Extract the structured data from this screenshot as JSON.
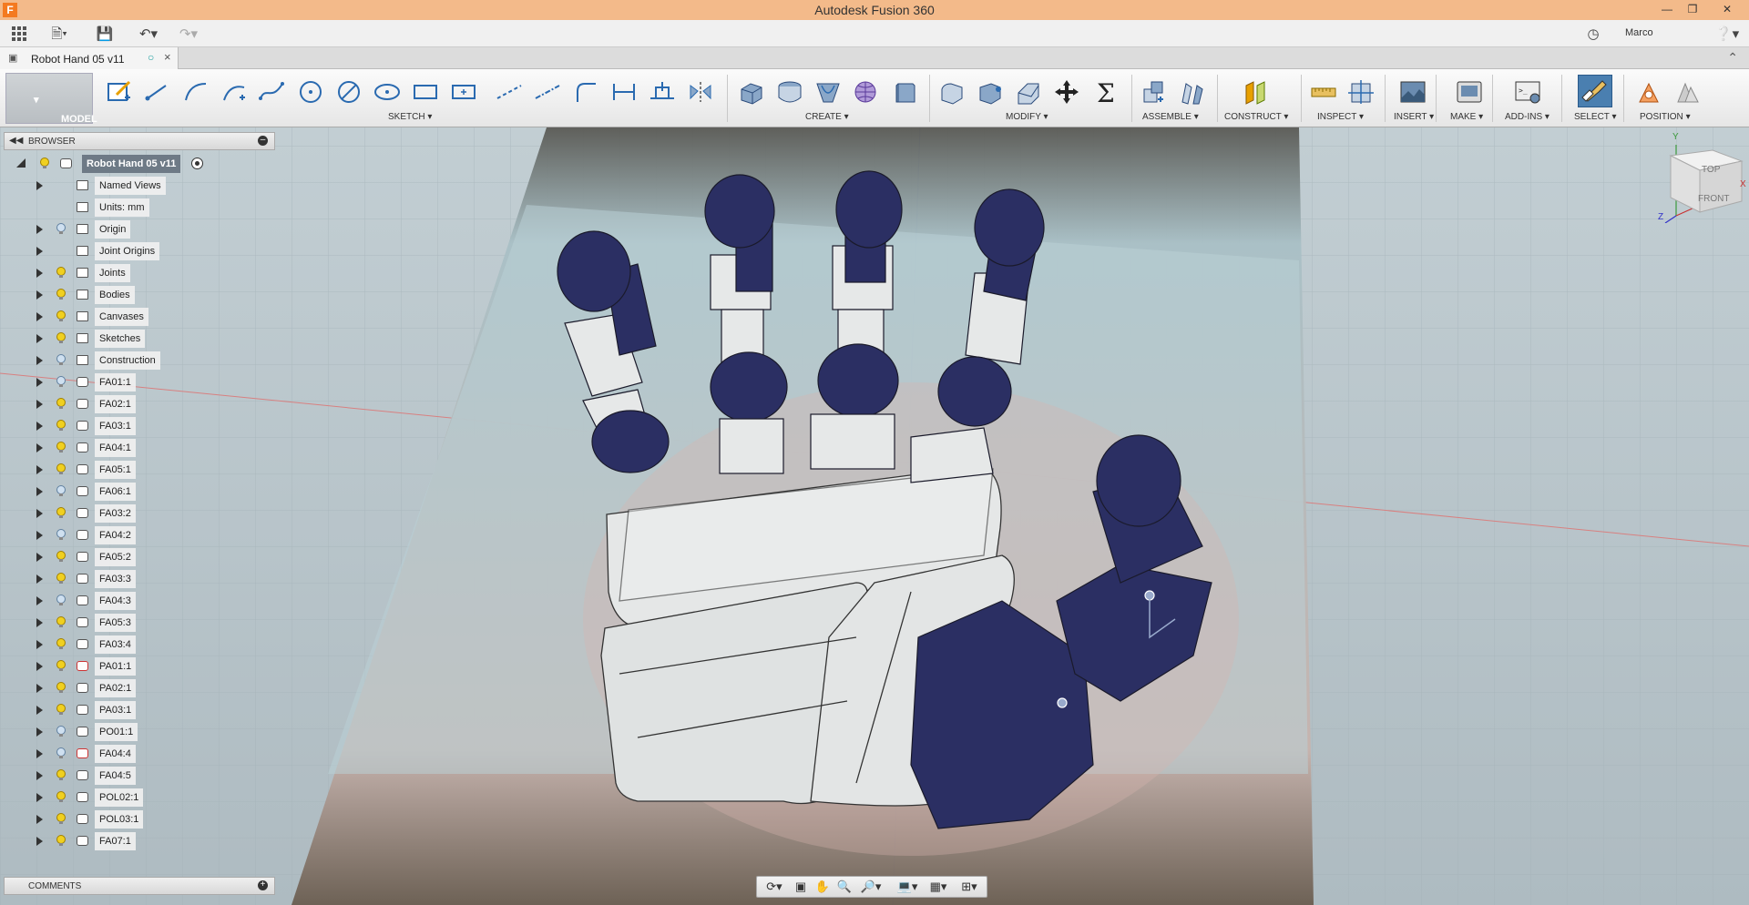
{
  "window": {
    "title": "Autodesk Fusion 360",
    "app_icon": "F",
    "controls": [
      "minimize-icon",
      "restore-icon",
      "close-icon"
    ]
  },
  "quick_access": {
    "user_name": "Marco",
    "icons": [
      "grid-menu-icon",
      "file-icon",
      "save-icon",
      "undo-icon",
      "redo-icon",
      "job-status-icon",
      "help-icon"
    ]
  },
  "document_tab": {
    "label": "Robot Hand 05 v11",
    "close_symbol": "×"
  },
  "toolbar": {
    "workspace_label": "MODEL",
    "groups": [
      {
        "label": "SKETCH"
      },
      {
        "label": "CREATE"
      },
      {
        "label": "MODIFY"
      },
      {
        "label": "ASSEMBLE"
      },
      {
        "label": "CONSTRUCT"
      },
      {
        "label": "INSPECT"
      },
      {
        "label": "INSERT"
      },
      {
        "label": "MAKE"
      },
      {
        "label": "ADD-INS"
      },
      {
        "label": "SELECT"
      },
      {
        "label": "POSITION"
      }
    ]
  },
  "browser": {
    "title": "BROWSER",
    "root": "Robot Hand 05 v11",
    "items": [
      {
        "label": "Named Views",
        "type": "folder",
        "bulb": false
      },
      {
        "label": "Units: mm",
        "type": "units",
        "bulb": false
      },
      {
        "label": "Origin",
        "type": "folder",
        "bulb": "off"
      },
      {
        "label": "Joint Origins",
        "type": "folder",
        "bulb": false
      },
      {
        "label": "Joints",
        "type": "folder",
        "bulb": "on"
      },
      {
        "label": "Bodies",
        "type": "folder",
        "bulb": "on"
      },
      {
        "label": "Canvases",
        "type": "folder",
        "bulb": "on"
      },
      {
        "label": "Sketches",
        "type": "folder",
        "bulb": "on"
      },
      {
        "label": "Construction",
        "type": "folder",
        "bulb": "off"
      },
      {
        "label": "FA01:1",
        "type": "comp",
        "bulb": "off"
      },
      {
        "label": "FA02:1",
        "type": "comp",
        "bulb": "on"
      },
      {
        "label": "FA03:1",
        "type": "comp",
        "bulb": "on"
      },
      {
        "label": "FA04:1",
        "type": "comp",
        "bulb": "on"
      },
      {
        "label": "FA05:1",
        "type": "comp",
        "bulb": "on"
      },
      {
        "label": "FA06:1",
        "type": "comp",
        "bulb": "off"
      },
      {
        "label": "FA03:2",
        "type": "comp",
        "bulb": "on"
      },
      {
        "label": "FA04:2",
        "type": "comp",
        "bulb": "off"
      },
      {
        "label": "FA05:2",
        "type": "comp",
        "bulb": "on"
      },
      {
        "label": "FA03:3",
        "type": "comp",
        "bulb": "on"
      },
      {
        "label": "FA04:3",
        "type": "comp",
        "bulb": "off"
      },
      {
        "label": "FA05:3",
        "type": "comp",
        "bulb": "on"
      },
      {
        "label": "FA03:4",
        "type": "comp",
        "bulb": "on"
      },
      {
        "label": "PA01:1",
        "type": "comp-flag",
        "bulb": "on"
      },
      {
        "label": "PA02:1",
        "type": "comp",
        "bulb": "on"
      },
      {
        "label": "PA03:1",
        "type": "comp",
        "bulb": "on"
      },
      {
        "label": "PO01:1",
        "type": "comp",
        "bulb": "off"
      },
      {
        "label": "FA04:4",
        "type": "comp-flag",
        "bulb": "off"
      },
      {
        "label": "FA04:5",
        "type": "comp",
        "bulb": "on"
      },
      {
        "label": "POL02:1",
        "type": "comp",
        "bulb": "on"
      },
      {
        "label": "POL03:1",
        "type": "comp",
        "bulb": "on"
      },
      {
        "label": "FA07:1",
        "type": "comp",
        "bulb": "on"
      }
    ]
  },
  "comments": {
    "title": "COMMENTS"
  },
  "viewcube": {
    "top": "TOP",
    "front": "FRONT",
    "axes": {
      "x": "X",
      "y": "Y",
      "z": "Z"
    }
  },
  "colors": {
    "title_bar": "#f3ba8a",
    "finger_caps": "#2a2d5e",
    "palm": "#e4e6e6",
    "grid": "#b9c6cc",
    "select_active": "#4a7fb0"
  }
}
